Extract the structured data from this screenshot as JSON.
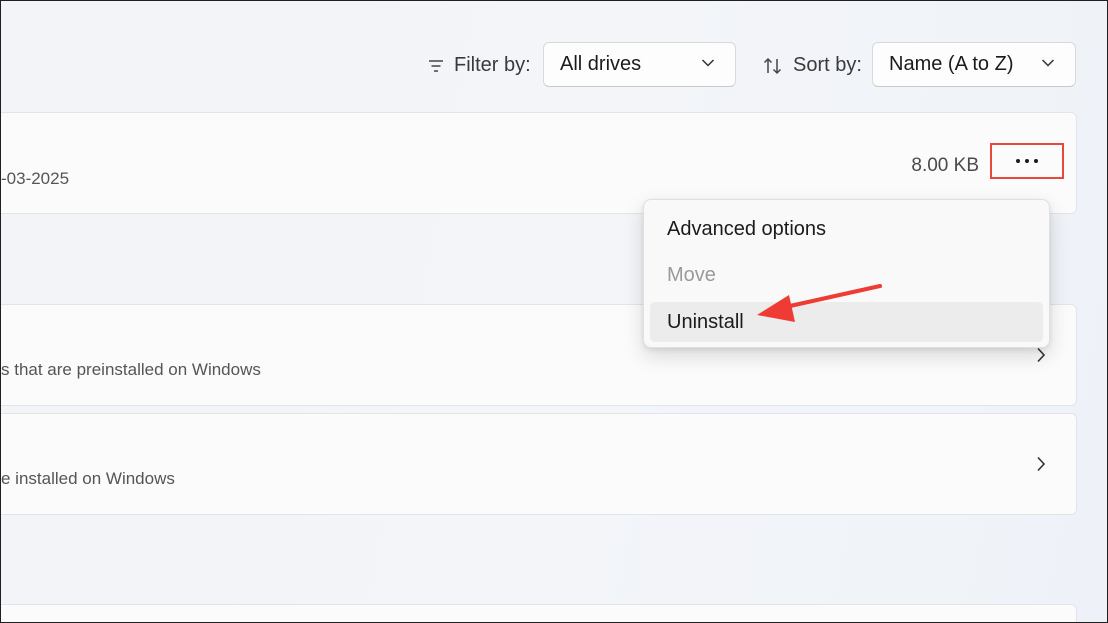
{
  "toolbar": {
    "filter_label": "Filter by:",
    "filter_value": "All drives",
    "sort_label": "Sort by:",
    "sort_value": "Name (A to Z)"
  },
  "app_item": {
    "date_partial": "-03-2025",
    "size": "8.00 KB"
  },
  "context_menu": {
    "items": [
      {
        "label": "Advanced options",
        "enabled": true
      },
      {
        "label": "Move",
        "enabled": false
      },
      {
        "label": "Uninstall",
        "enabled": true,
        "hovered": true
      }
    ]
  },
  "rows": [
    {
      "subtitle": "s that are preinstalled on Windows"
    },
    {
      "subtitle": "e installed on Windows"
    }
  ],
  "colors": {
    "highlight_box": "#e8473b",
    "arrow": "#ee3b33",
    "menu_hover": "#ececec"
  },
  "icons": [
    "filter-icon",
    "sort-icon",
    "chevron-down-icon",
    "more-icon",
    "chevron-right-icon",
    "arrow-annotation"
  ]
}
